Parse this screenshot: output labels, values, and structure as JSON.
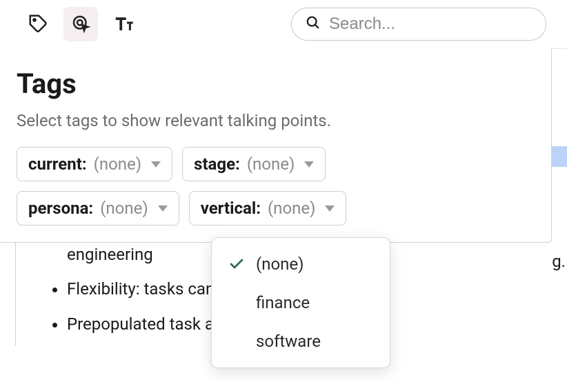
{
  "toolbar": {
    "search_placeholder": "Search..."
  },
  "panel": {
    "title": "Tags",
    "description": "Select tags to show relevant talking points.",
    "filters": {
      "current": {
        "label": "current:",
        "value": "(none)"
      },
      "stage": {
        "label": "stage:",
        "value": "(none)"
      },
      "persona": {
        "label": "persona:",
        "value": "(none)"
      },
      "vertical": {
        "label": "vertical:",
        "value": "(none)"
      }
    }
  },
  "dropdown": {
    "options": [
      {
        "label": "(none)",
        "selected": true
      },
      {
        "label": "finance",
        "selected": false
      },
      {
        "label": "software",
        "selected": false
      }
    ]
  },
  "background": {
    "line1": "engineering",
    "line2": "Flexibility: tasks can                       gidly defined hierarchy",
    "line3": "Prepopulated task                         also easy to extend"
  },
  "partial_letter": "g."
}
